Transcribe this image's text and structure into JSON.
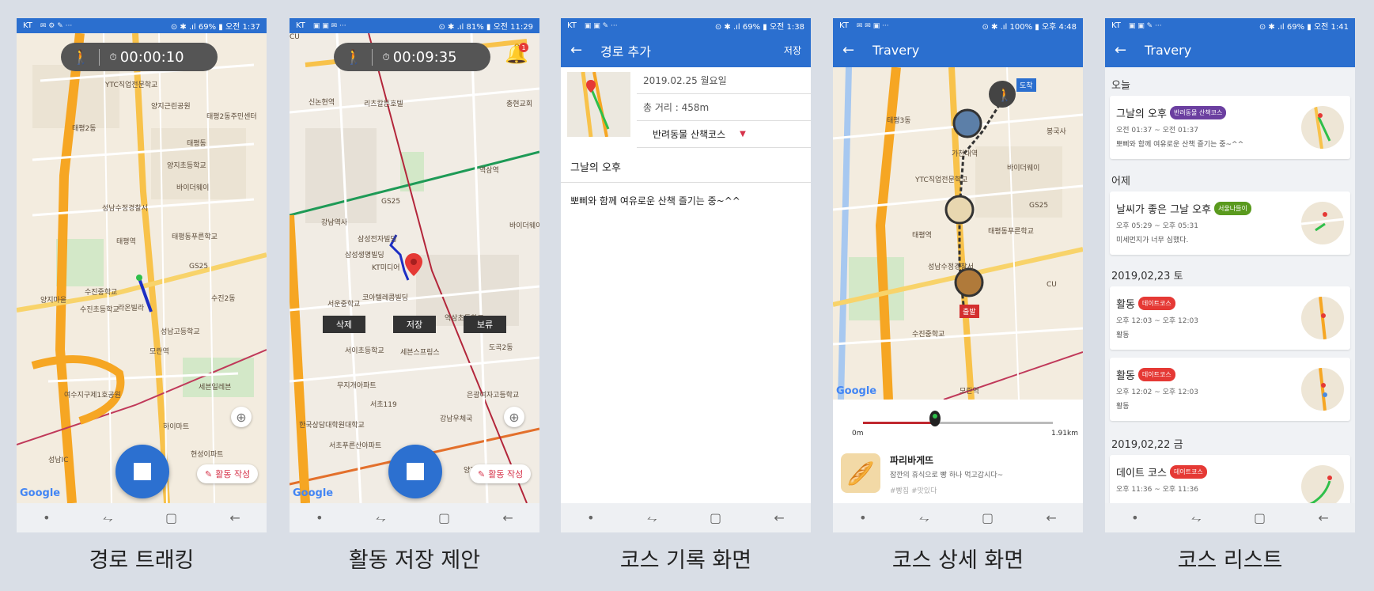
{
  "status_bars": [
    {
      "carrier": "KT",
      "icons": "✉ ⚙ ✎ ···",
      "right": "⊙ ✱ .ıl 69% ▮ 오전 1:37"
    },
    {
      "carrier": "KT",
      "icons": "▣ ▣ ✉ ···",
      "right": "⊙ ✱ .ıl 81% ▮ 오전 11:29"
    },
    {
      "carrier": "KT",
      "icons": "▣ ▣ ✎ ···",
      "right": "⊙ ✱ .ıl 69% ▮ 오전 1:38"
    },
    {
      "carrier": "KT",
      "icons": "✉ ✉ ▣ ···",
      "right": "⊙ ✱ .ıl 100% ▮ 오후 4:48"
    },
    {
      "carrier": "KT",
      "icons": "▣ ▣ ✎ ···",
      "right": "⊙ ✱ .ıl 69% ▮ 오전 1:41"
    }
  ],
  "nav": {
    "dot": "•",
    "recent": "⥊",
    "home": "▢",
    "back": "←"
  },
  "screen1": {
    "timer": "00:00:10",
    "write_label": "활동 작성",
    "map_labels": [
      "YTC직업전문학교",
      "태평2동",
      "태평2동주민센터",
      "양지근린공원",
      "양지초등학교",
      "성남수정경찰서",
      "태평역",
      "태평동푸른학교",
      "수진중학교",
      "라온빌라",
      "수진초등학교",
      "성남고등학교",
      "모란역",
      "성남IC",
      "여수지구제1호공원",
      "현성이파트",
      "세븐일레븐",
      "하이마트",
      "태평동",
      "바이더웨이",
      "GS25",
      "양지마을",
      "수진2동"
    ],
    "google": "Google"
  },
  "screen2": {
    "timer": "00:09:35",
    "badge": "1",
    "buttons": [
      "삭제",
      "저장",
      "보류"
    ],
    "write_label": "활동 작성",
    "map_labels": [
      "신논현역",
      "리츠칼튼호텔",
      "충현교회",
      "강남역사",
      "역삼역",
      "삼성전자빌딩",
      "삼성생명빌딩",
      "KT미디어",
      "코아텔레콤빌딩",
      "서운중학교",
      "서이초등학교",
      "세븐스프링스",
      "역삼초등학교",
      "무지개아파트",
      "서초119",
      "한국상담대학원대학교",
      "서초푸른산아파트",
      "양재역",
      "도곡2동",
      "은광여자고등학교",
      "강남우체국",
      "CU",
      "GS25",
      "바이더웨이"
    ],
    "google": "Google"
  },
  "screen3": {
    "appbar_title": "경로 추가",
    "save_label": "저장",
    "date": "2019.02.25 월요일",
    "distance": "총 거리 : 458m",
    "course_type": "반려동물 산책코스",
    "title": "그날의 오후",
    "memo": "뽀삐와 함께 여유로운 산책 즐기는 중~^^"
  },
  "screen4": {
    "appbar_title": "Travery",
    "arrive_label": "도착",
    "start_label": "출발",
    "map_labels": [
      "가천대역",
      "태평3동",
      "YTC직업전문학교",
      "태평역",
      "성남수정경찰서",
      "수진중학교",
      "태평동푸른학교",
      "모란역",
      "GS25",
      "CU",
      "바이더웨이",
      "봉국사"
    ],
    "slider_min": "0m",
    "slider_max": "1.91km",
    "slider_position": 0.38,
    "place_name": "파리바게뜨",
    "place_desc": "잠깐의 휴식으로 빵 하나 먹고갑시다~",
    "place_tags": "#빵집 #맛있다",
    "google": "Google"
  },
  "screen5": {
    "appbar_title": "Travery",
    "sections": [
      {
        "label": "오늘",
        "cards": [
          {
            "title": "그날의 오후",
            "tag": "반려동물 산책코스",
            "tag_color": "#6b3fa0",
            "time": "오전 01:37 ~ 오전 01:37",
            "desc": "뽀삐와 함께 여유로운 산책 즐기는 중~^^"
          }
        ]
      },
      {
        "label": "어제",
        "cards": [
          {
            "title": "날씨가 좋은 그날 오후",
            "tag": "서울나들이",
            "tag_color": "#5a9a1e",
            "time": "오후 05:29 ~ 오후 05:31",
            "desc": "미세먼지가 너무 심했다."
          }
        ]
      },
      {
        "label": "2019,02,23 토",
        "cards": [
          {
            "title": "활동",
            "tag": "데이트코스",
            "tag_color": "#e53935",
            "time": "오후 12:03 ~ 오후 12:03",
            "desc": "활동"
          },
          {
            "title": "활동",
            "tag": "데이트코스",
            "tag_color": "#e53935",
            "time": "오후 12:02 ~ 오후 12:03",
            "desc": "활동"
          }
        ]
      },
      {
        "label": "2019,02,22 금",
        "cards": [
          {
            "title": "데이트 코스",
            "tag": "데이트코스",
            "tag_color": "#e53935",
            "time": "오후 11:36 ~ 오후 11:36",
            "desc": ""
          }
        ]
      }
    ]
  },
  "captions": [
    "경로 트래킹",
    "활동 저장 제안",
    "코스 기록 화면",
    "코스 상세 화면",
    "코스 리스트"
  ]
}
